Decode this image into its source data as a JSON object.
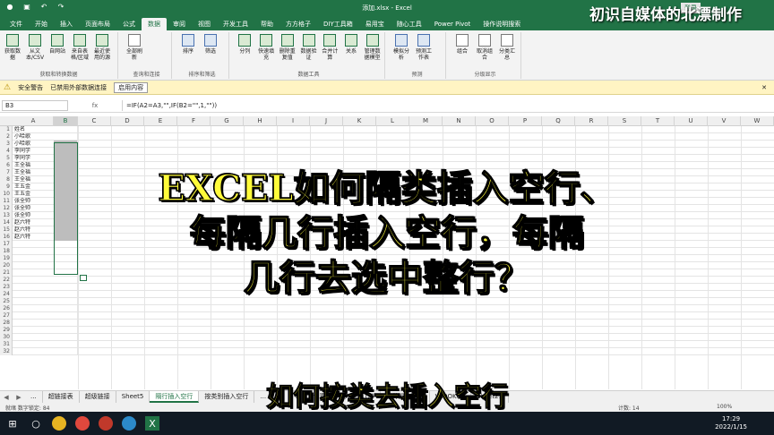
{
  "titlebar": {
    "doc_title": "添加.xlsx - Excel",
    "account": "登录"
  },
  "ribbon_tabs": [
    "文件",
    "开始",
    "插入",
    "页面布局",
    "公式",
    "数据",
    "审阅",
    "视图",
    "开发工具",
    "帮助",
    "方方格子",
    "DIY工具箱",
    "易用宝",
    "随心工具",
    "Power Pivot",
    "操作说明搜索"
  ],
  "ribbon_active_tab": "数据",
  "ribbon_groups": [
    {
      "label": "获取和转换数据",
      "buttons": [
        "获取数据",
        "从文本/CSV",
        "自网站",
        "来自表格/区域",
        "最近使用的源"
      ]
    },
    {
      "label": "查询和连接",
      "buttons": [
        "全部刷新"
      ]
    },
    {
      "label": "排序和筛选",
      "buttons": [
        "排序",
        "筛选"
      ]
    },
    {
      "label": "数据工具",
      "buttons": [
        "分列",
        "快速填充",
        "删除重复值",
        "数据验证",
        "合并计算",
        "关系",
        "管理数据模型"
      ]
    },
    {
      "label": "预测",
      "buttons": [
        "模拟分析",
        "预测工作表"
      ]
    },
    {
      "label": "分级显示",
      "buttons": [
        "组合",
        "取消组合",
        "分类汇总"
      ]
    }
  ],
  "security_bar": {
    "label": "安全警告",
    "message": "已禁用外部数据连接",
    "button": "启用内容"
  },
  "formula_bar": {
    "name_box": "B3",
    "fx": "fx",
    "formula": "=IF(A2=A3,\"\",IF(B2=\"\",1,\"\"))"
  },
  "columns": [
    "A",
    "B",
    "C",
    "D",
    "E",
    "F",
    "G",
    "H",
    "I",
    "J",
    "K",
    "L",
    "M",
    "N",
    "O",
    "P",
    "Q",
    "R",
    "S",
    "T",
    "U",
    "V",
    "W"
  ],
  "rows": [
    {
      "n": "1",
      "a": "姓名"
    },
    {
      "n": "2",
      "a": "小哈歌"
    },
    {
      "n": "3",
      "a": "小哈歌"
    },
    {
      "n": "4",
      "a": "李同学"
    },
    {
      "n": "5",
      "a": "李同学"
    },
    {
      "n": "6",
      "a": "王全福"
    },
    {
      "n": "7",
      "a": "王全福"
    },
    {
      "n": "8",
      "a": "王全福"
    },
    {
      "n": "9",
      "a": "王五金"
    },
    {
      "n": "10",
      "a": "王五金"
    },
    {
      "n": "11",
      "a": "张全帅"
    },
    {
      "n": "12",
      "a": "张全帅"
    },
    {
      "n": "13",
      "a": "张全帅"
    },
    {
      "n": "14",
      "a": "赵六特"
    },
    {
      "n": "15",
      "a": "赵六特"
    },
    {
      "n": "16",
      "a": "赵六特"
    },
    {
      "n": "17",
      "a": ""
    },
    {
      "n": "18",
      "a": ""
    },
    {
      "n": "19",
      "a": ""
    },
    {
      "n": "20",
      "a": ""
    },
    {
      "n": "21",
      "a": ""
    },
    {
      "n": "22",
      "a": ""
    },
    {
      "n": "23",
      "a": ""
    },
    {
      "n": "24",
      "a": ""
    },
    {
      "n": "25",
      "a": ""
    },
    {
      "n": "26",
      "a": ""
    },
    {
      "n": "27",
      "a": ""
    },
    {
      "n": "28",
      "a": ""
    },
    {
      "n": "29",
      "a": ""
    },
    {
      "n": "30",
      "a": ""
    },
    {
      "n": "31",
      "a": ""
    },
    {
      "n": "32",
      "a": ""
    }
  ],
  "filled_rows": [
    "3",
    "4",
    "5",
    "6",
    "7",
    "8",
    "9",
    "10",
    "11",
    "12",
    "13",
    "14",
    "15",
    "16"
  ],
  "sheet_tabs": [
    "...",
    "超链接表",
    "超级链接",
    "Sheet5",
    "隔行插入空行",
    "按类别插入空行",
    "...",
    "...",
    "...",
    "设置隔行插入空行 (2)",
    "三种提取方法",
    "VLOOKUP",
    "Sheet21"
  ],
  "sheet_active_index": 4,
  "status": {
    "ready": "就绪  数字锁定: 84",
    "count": "计数: 14",
    "zoom": "100%"
  },
  "clock": {
    "time": "17:29",
    "date": "2022/1/15"
  },
  "watermark": "初识自媒体的北漂制作",
  "overlay": {
    "line1": "EXCEL如何隔类插入空行、",
    "line2": "每隔几行插入空行，每隔",
    "line3": "几行去选中整行？",
    "bottom": "如何按类去插入空行"
  },
  "colors": {
    "excel_green": "#217346",
    "overlay_text": "#fffb3a",
    "selection_fill": "#bdbdbd"
  }
}
